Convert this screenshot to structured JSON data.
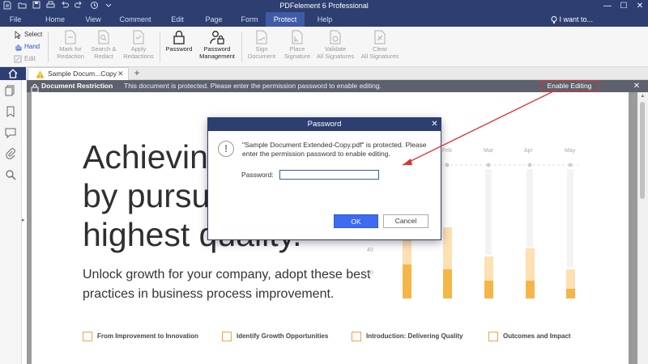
{
  "window": {
    "title": "PDFelement 6 Professional",
    "minimize": "—",
    "maximize": "☐",
    "close": "✕"
  },
  "menu": {
    "items": [
      "File",
      "Home",
      "View",
      "Comment",
      "Edit",
      "Page",
      "Form",
      "Protect",
      "Help"
    ],
    "active": "Protect",
    "i_want_to": "I want to..."
  },
  "ribbon": {
    "select": "Select",
    "hand": "Hand",
    "edit": "Edit",
    "mark_for_redaction": [
      "Mark for",
      "Redaction"
    ],
    "search_redact": [
      "Search &",
      "Redact"
    ],
    "apply_redactions": [
      "Apply",
      "Redactions"
    ],
    "password": "Password",
    "password_management": [
      "Password",
      "Management"
    ],
    "sign_document": [
      "Sign",
      "Document"
    ],
    "place_signature": [
      "Place",
      "Signature"
    ],
    "validate_all": [
      "Validate",
      "All Signatures"
    ],
    "clear_all": [
      "Clear",
      "All Signatures"
    ]
  },
  "tabs": {
    "document": "Sample Docum...Copy",
    "add": "+"
  },
  "restriction": {
    "title": "Document Restriction",
    "message": "This document is protected. Please enter the permission password to enable editing.",
    "enable_editing": "Enable Editing",
    "close": "✕"
  },
  "document": {
    "headline_lines": [
      "Achievin",
      "by pursu",
      "highest quality."
    ],
    "subtitle_lines": [
      "Unlock growth for your company, adopt these best",
      "practices in business process improvement."
    ],
    "footer_items": [
      "From Improvement to Innovation",
      "Identify Growth Opportunities",
      "Introduction: Delivering Quality",
      "Outcomes and Impact"
    ],
    "chart_months": [
      "Feb",
      "Mar",
      "Apr",
      "May"
    ],
    "chart_ticks": [
      "40",
      "20"
    ]
  },
  "dialog": {
    "title": "Password",
    "close": "✕",
    "message": "\"Sample Document Extended-Copy.pdf\" is protected. Please enter the permission password to enable editing.",
    "password_label": "Password:",
    "password_value": "",
    "ok": "OK",
    "cancel": "Cancel"
  },
  "colors": {
    "title_bar": "#2d3e70",
    "active_menu": "#3e5ba7",
    "restriction_bar": "#5c616c",
    "ok_button": "#3d6bf2",
    "annotation_red": "#e03030",
    "chart_orange": "#f5b648",
    "chart_light": "#fde0b3"
  }
}
